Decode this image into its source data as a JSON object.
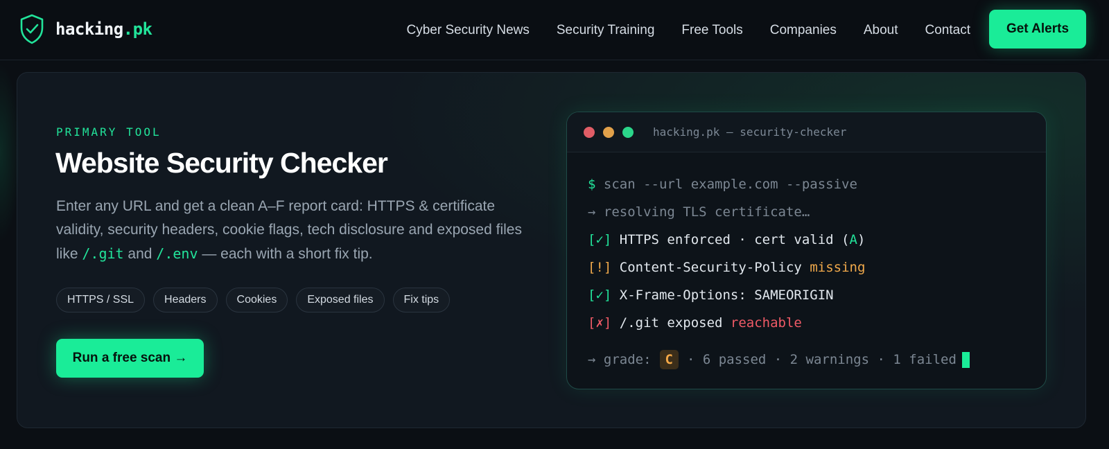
{
  "header": {
    "logo": {
      "name": "hacking",
      "tld": ".pk"
    },
    "nav": [
      "Cyber Security News",
      "Security Training",
      "Free Tools",
      "Companies",
      "About",
      "Contact"
    ],
    "cta_label": "Get Alerts"
  },
  "hero": {
    "eyebrow": "PRIMARY TOOL",
    "title": "Website Security Checker",
    "description": {
      "part1": "Enter any URL and get a clean A–F report card: HTTPS & certificate validity, security headers, cookie flags, tech disclosure and exposed files like ",
      "code1": "/.git",
      "part2": " and ",
      "code2": "/.env",
      "part3": " — each with a short fix tip."
    },
    "chips": [
      "HTTPS / SSL",
      "Headers",
      "Cookies",
      "Exposed files",
      "Fix tips"
    ],
    "cta_label": "Run a free scan →"
  },
  "terminal": {
    "title": "hacking.pk — security-checker",
    "prompt": "$",
    "command": " scan --url example.com --passive",
    "resolving": "→ resolving TLS certificate…",
    "results": [
      {
        "mark": "[✓]",
        "text": " HTTPS enforced · cert valid (",
        "highlight": "A",
        "suffix": ")",
        "status": "ok"
      },
      {
        "mark": "[!]",
        "text": " Content-Security-Policy ",
        "highlight": "missing",
        "suffix": "",
        "status": "warn"
      },
      {
        "mark": "[✓]",
        "text": " X-Frame-Options: SAMEORIGIN",
        "highlight": "",
        "suffix": "",
        "status": "ok"
      },
      {
        "mark": "[✗]",
        "text": " /.git exposed ",
        "highlight": "reachable",
        "suffix": "",
        "status": "bad"
      }
    ],
    "grade_prefix": "→ grade:",
    "grade": "C",
    "summary": "· 6 passed · 2 warnings · 1 failed"
  },
  "colors": {
    "accent": "#1aec98",
    "warning": "#f0a94b",
    "danger": "#ef5a66",
    "background": "#0b0f14"
  }
}
